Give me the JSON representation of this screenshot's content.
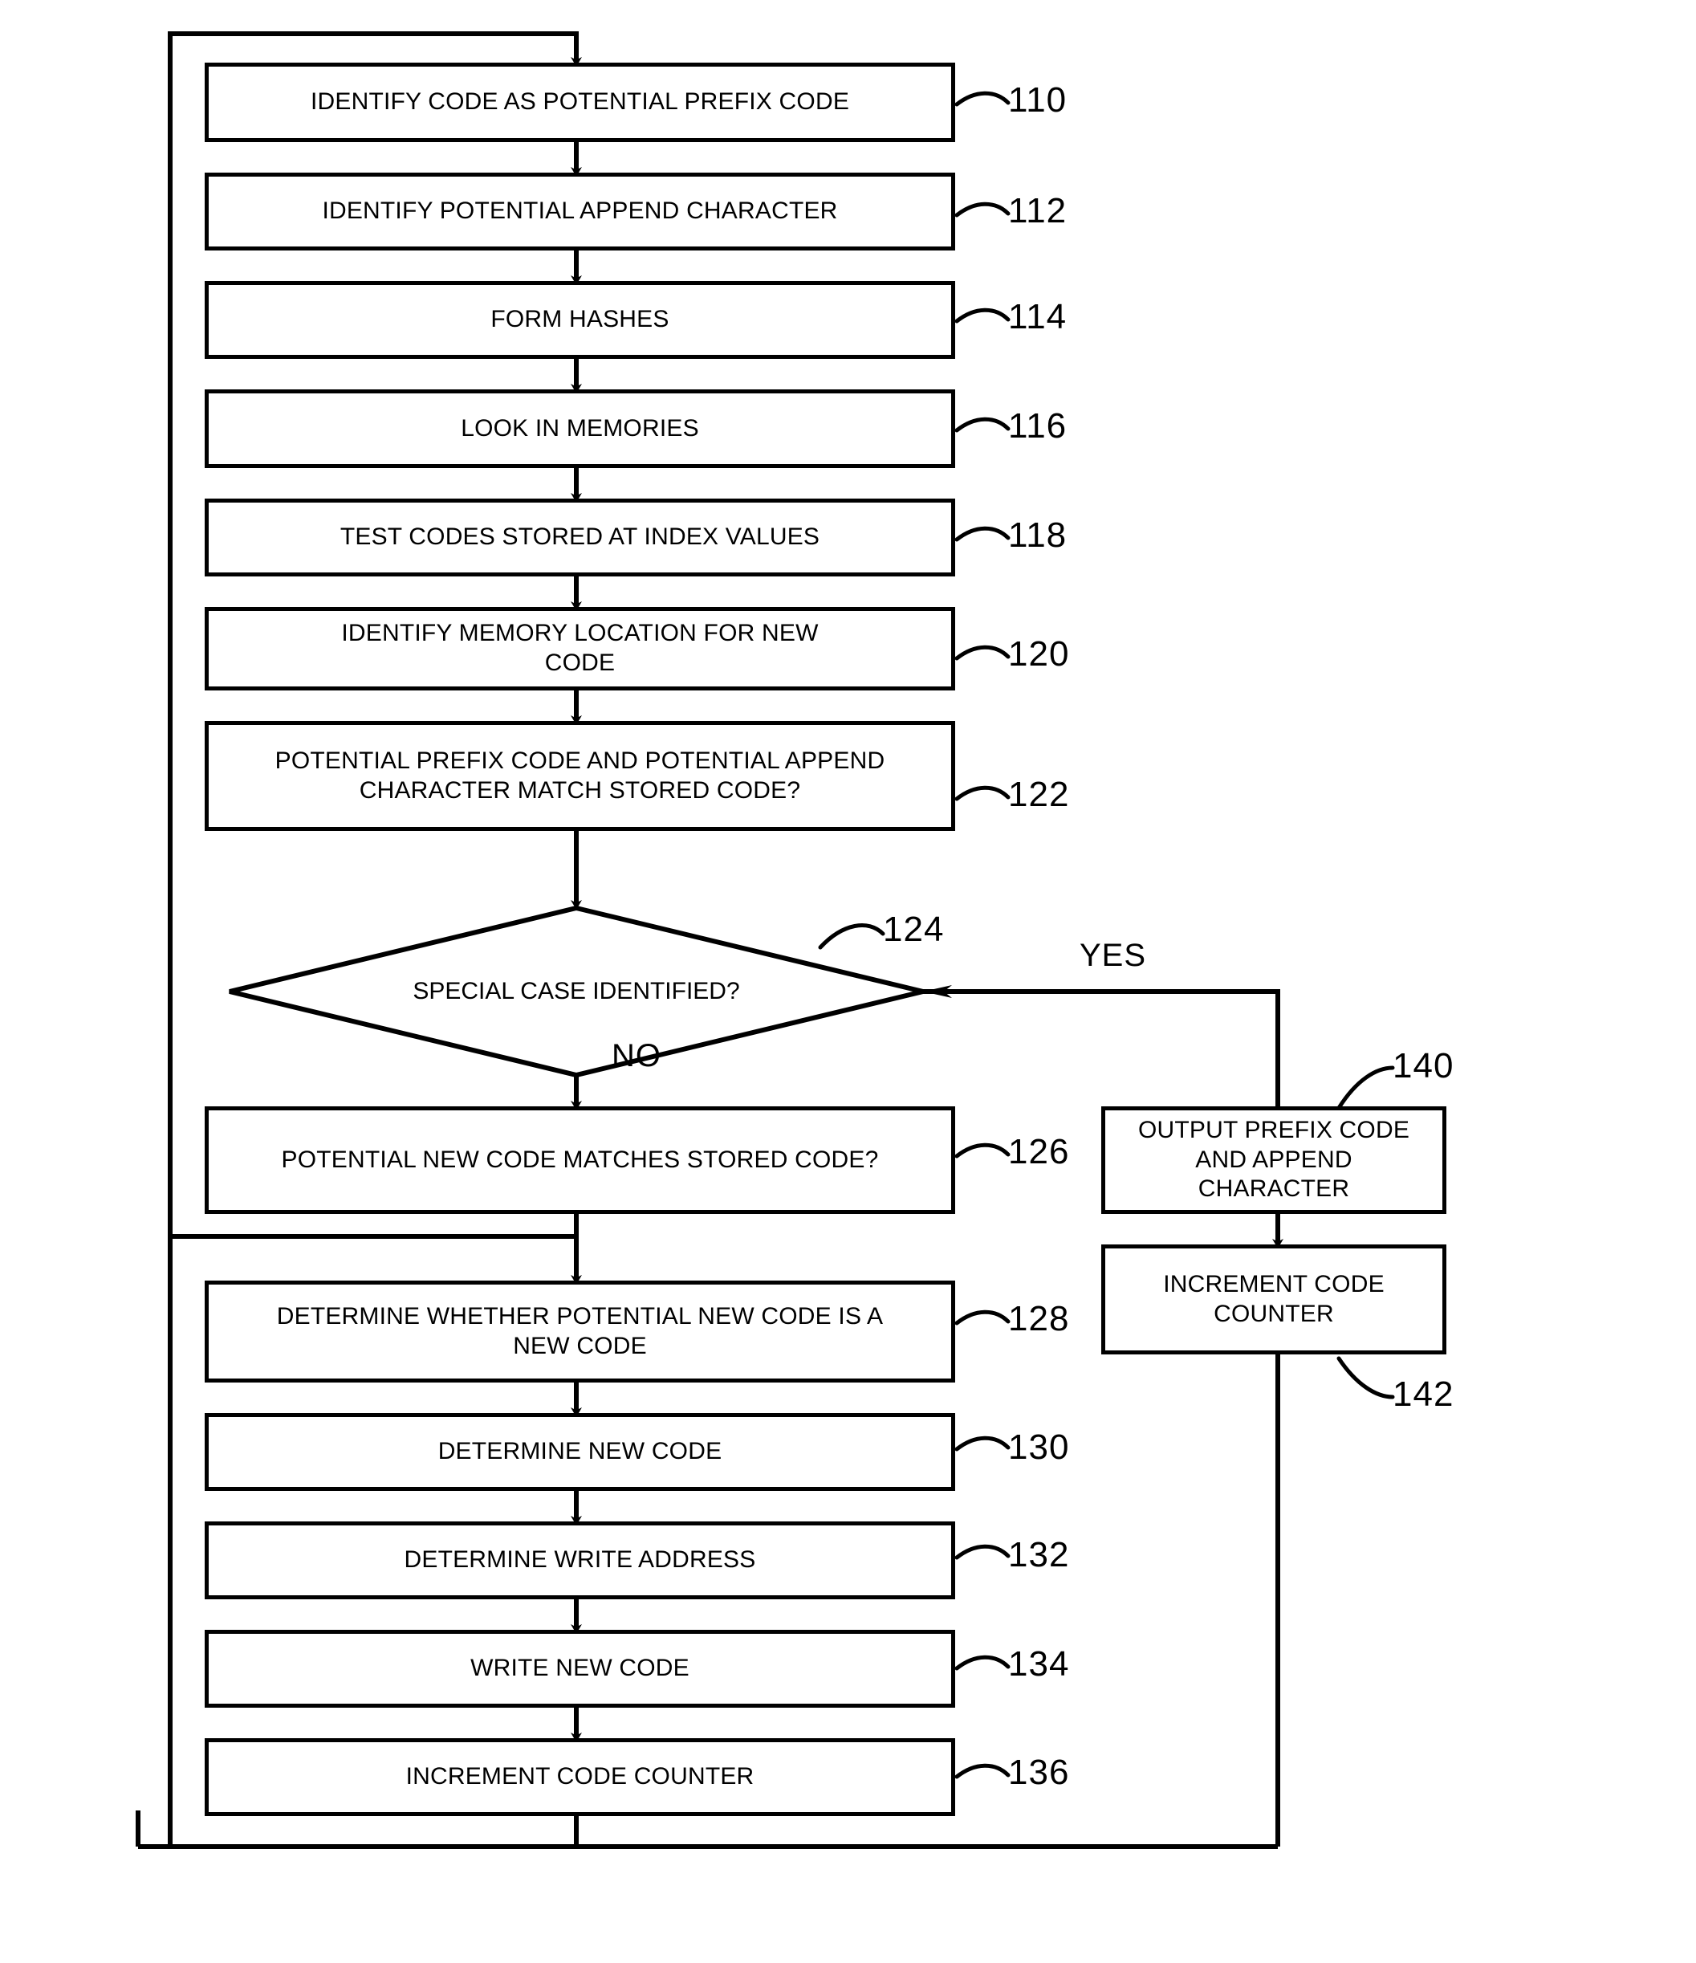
{
  "diagram": {
    "type": "patent-flowchart",
    "background_color": "#ffffff",
    "line_color": "#000000",
    "process_nodes": [
      {
        "id": "n110",
        "ref": "110",
        "label": "IDENTIFY CODE AS POTENTIAL PREFIX CODE"
      },
      {
        "id": "n112",
        "ref": "112",
        "label": "IDENTIFY POTENTIAL APPEND CHARACTER"
      },
      {
        "id": "n114",
        "ref": "114",
        "label": "FORM HASHES"
      },
      {
        "id": "n116",
        "ref": "116",
        "label": "LOOK IN MEMORIES"
      },
      {
        "id": "n118",
        "ref": "118",
        "label": "TEST CODES STORED AT INDEX VALUES"
      },
      {
        "id": "n120",
        "ref": "120",
        "label": "IDENTIFY MEMORY LOCATION FOR NEW CODE"
      },
      {
        "id": "n122",
        "ref": "122",
        "label": "POTENTIAL PREFIX CODE AND POTENTIAL APPEND CHARACTER MATCH STORED CODE?"
      },
      {
        "id": "n126",
        "ref": "126",
        "label": "POTENTIAL NEW CODE MATCHES STORED CODE?"
      },
      {
        "id": "n128",
        "ref": "128",
        "label": "DETERMINE WHETHER POTENTIAL NEW CODE IS A NEW CODE"
      },
      {
        "id": "n130",
        "ref": "130",
        "label": "DETERMINE NEW CODE"
      },
      {
        "id": "n132",
        "ref": "132",
        "label": "DETERMINE WRITE ADDRESS"
      },
      {
        "id": "n134",
        "ref": "134",
        "label": "WRITE NEW CODE"
      },
      {
        "id": "n136",
        "ref": "136",
        "label": "INCREMENT CODE COUNTER"
      },
      {
        "id": "n140",
        "ref": "140",
        "label": "OUTPUT PREFIX CODE AND APPEND CHARACTER"
      },
      {
        "id": "n142",
        "ref": "142",
        "label": "INCREMENT CODE COUNTER"
      }
    ],
    "decision_nodes": [
      {
        "id": "n124",
        "ref": "124",
        "label": "SPECIAL CASE IDENTIFIED?"
      }
    ],
    "branch_labels": [
      {
        "id": "yes",
        "label": "YES"
      },
      {
        "id": "no",
        "label": "NO"
      }
    ]
  }
}
